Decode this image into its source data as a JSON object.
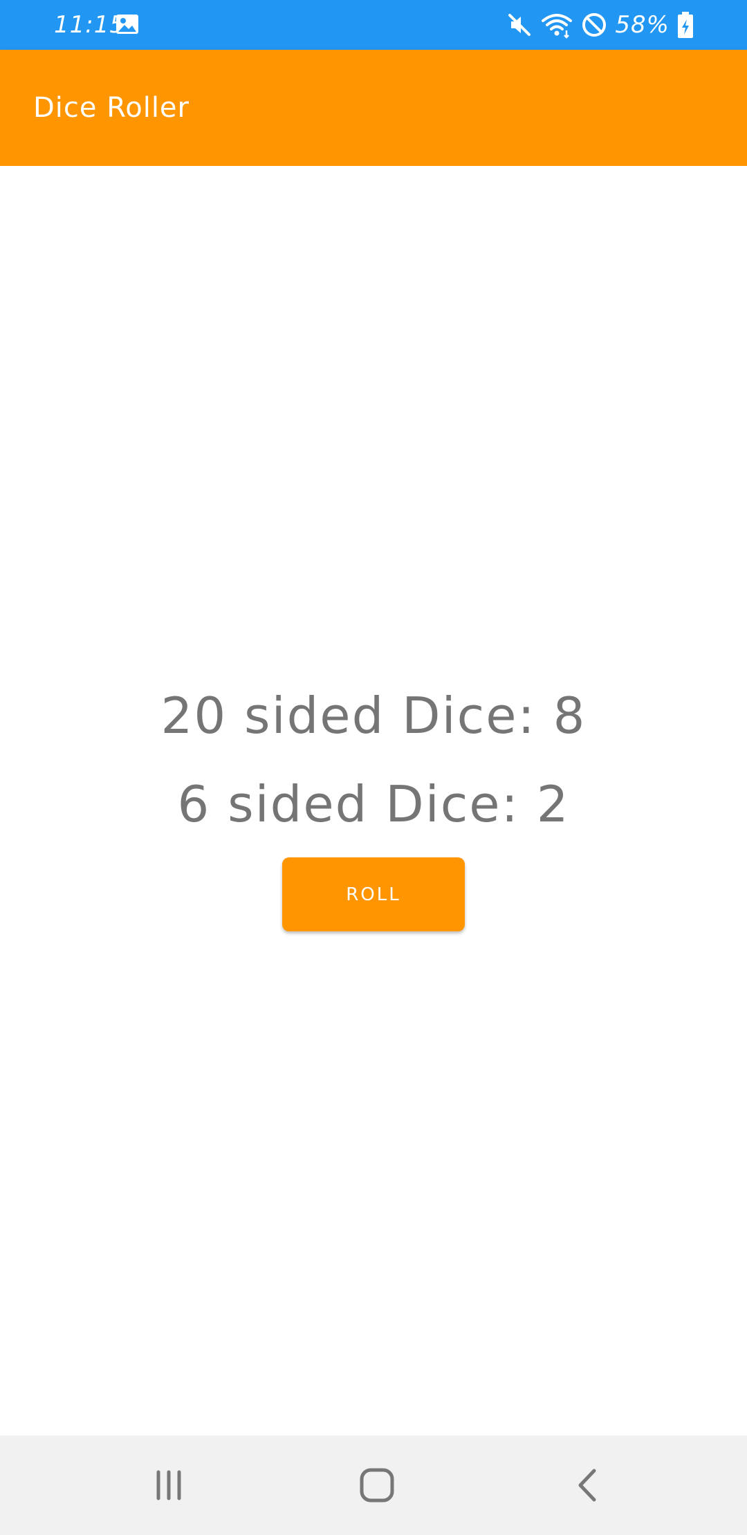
{
  "status_bar": {
    "time": "11:15",
    "battery_percent": "58%",
    "background_color": "#2196f3",
    "icons": [
      "gallery-icon",
      "mute-icon",
      "wifi-icon",
      "do-not-disturb-icon",
      "battery-charging-icon"
    ]
  },
  "app_bar": {
    "title": "Dice Roller",
    "background_color": "#ff9500"
  },
  "main": {
    "dice_20_text": "20 sided Dice: 8",
    "dice_6_text": "6 sided Dice: 2",
    "roll_button_label": "ROLL",
    "text_color": "#757575",
    "accent_color": "#ff9500"
  },
  "nav_bar": {
    "buttons": [
      "recents-icon",
      "home-icon",
      "back-icon"
    ]
  }
}
